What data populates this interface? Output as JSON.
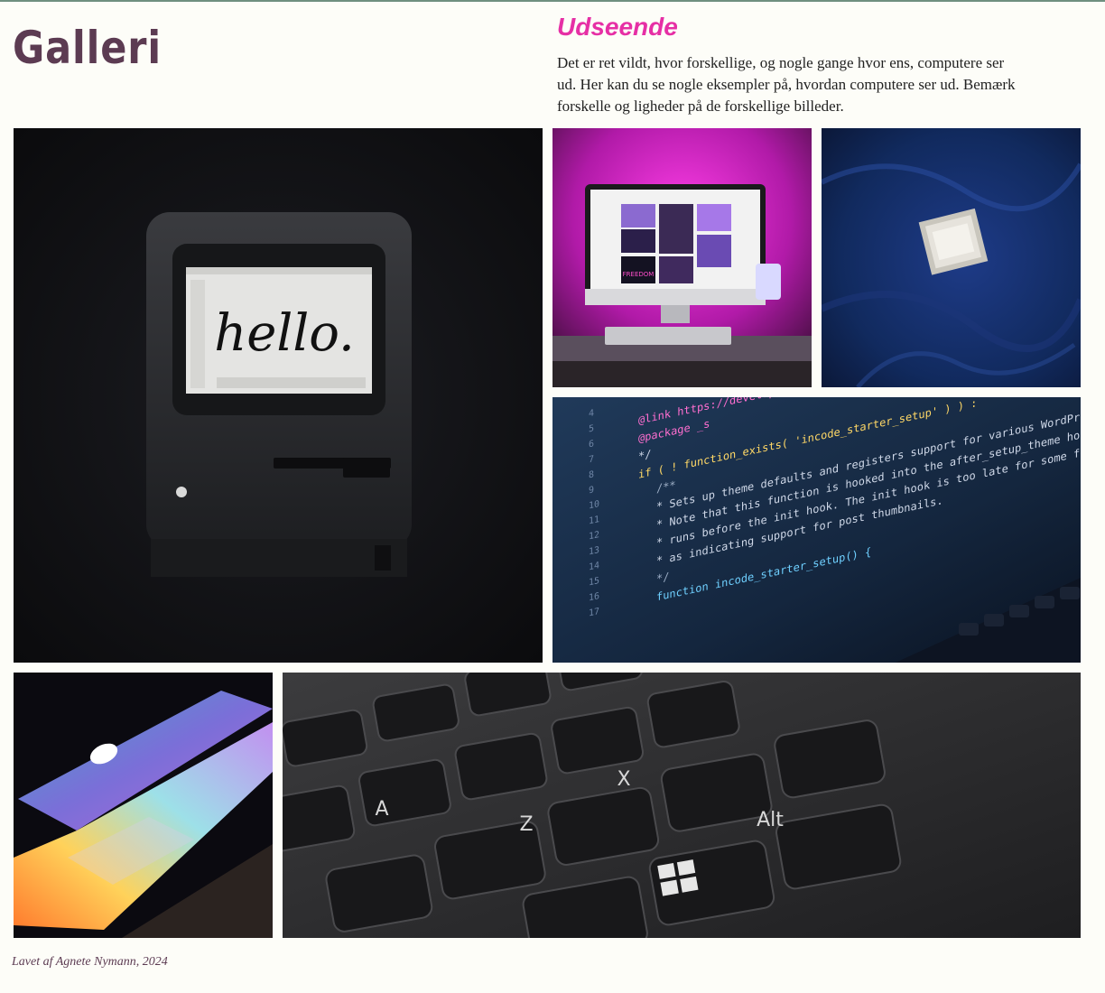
{
  "header": {
    "title": "Galleri",
    "section_heading": "Udseende",
    "intro": "Det er ret vildt, hvor forskellige, og nogle gange hvor ens, computere ser ud. Her kan du se nogle eksempler på, hvordan computere ser ud. Bemærk forskelle og ligheder på de forskellige billeder."
  },
  "gallery": {
    "items": [
      {
        "subject": "vintage-macintosh",
        "screen_text": "hello."
      },
      {
        "subject": "imac-pink-light",
        "screen_text": "FREEDOM"
      },
      {
        "subject": "cpu-chip-on-blue-fabric"
      },
      {
        "subject": "laptop-code-screen",
        "code_lines": [
          "@link https://developer.wordpress.org/",
          "@package _s",
          "*/",
          "if ( ! function_exists( 'incode_starter_setup' ) ) :",
          "/**",
          "* Sets up theme defaults and registers support for various WordPress features.",
          "* Note that this function is hooked into the after_setup_theme hook, which",
          "* runs before the init hook. The init hook is too late for some features, such",
          "* as indicating support for post thumbnails.",
          "*/",
          "function incode_starter_setup() {"
        ],
        "line_numbers": [
          "4",
          "5",
          "6",
          "7",
          "8",
          "9",
          "10",
          "11",
          "12",
          "13",
          "14",
          "15",
          "16",
          "17"
        ]
      },
      {
        "subject": "macbook-rainbow-light"
      },
      {
        "subject": "keyboard-closeup",
        "key_labels": [
          "A",
          "Z",
          "X",
          "Alt"
        ]
      }
    ]
  },
  "footer": {
    "credit": "Lavet af Agnete Nymann, 2024"
  },
  "colors": {
    "title": "#5c3b52",
    "heading": "#e62fa5",
    "background": "#fdfdf8"
  }
}
